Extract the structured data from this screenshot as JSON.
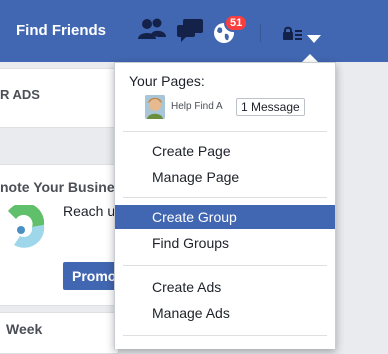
{
  "header": {
    "find_friends": "Find Friends",
    "notifications_count": "51"
  },
  "background": {
    "ads_label": "R ADS",
    "promote_text": "note Your Busine",
    "reach_text": "Reach u",
    "promote_button": "Promo",
    "week_label": "Week"
  },
  "dropdown": {
    "your_pages_label": "Your Pages:",
    "page_name": "Help Find A",
    "message_badge": "1 Message",
    "items": {
      "create_page": "Create Page",
      "manage_page": "Manage Page",
      "create_group": "Create Group",
      "find_groups": "Find Groups",
      "create_ads": "Create Ads",
      "manage_ads": "Manage Ads"
    }
  },
  "colors": {
    "brand": "#4267b2",
    "badge": "#fa3e3e"
  }
}
